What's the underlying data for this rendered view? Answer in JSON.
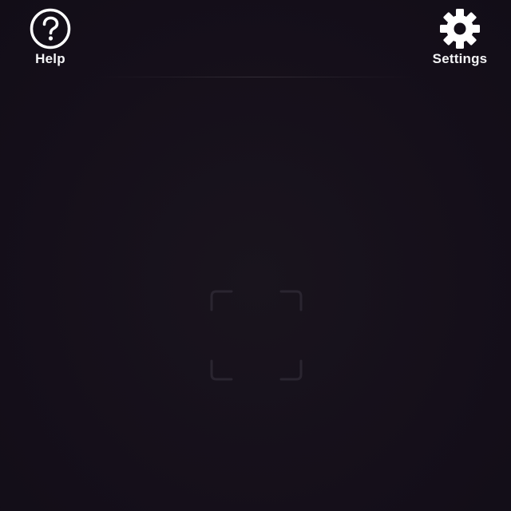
{
  "header": {
    "help": {
      "label": "Help",
      "icon": "question-circle-icon"
    },
    "settings": {
      "label": "Settings",
      "icon": "gear-icon"
    }
  },
  "viewfinder": {
    "icon": "scan-frame-icon"
  },
  "colors": {
    "background": "#140f19",
    "icon": "#ffffff",
    "frame": "#2a2530"
  }
}
